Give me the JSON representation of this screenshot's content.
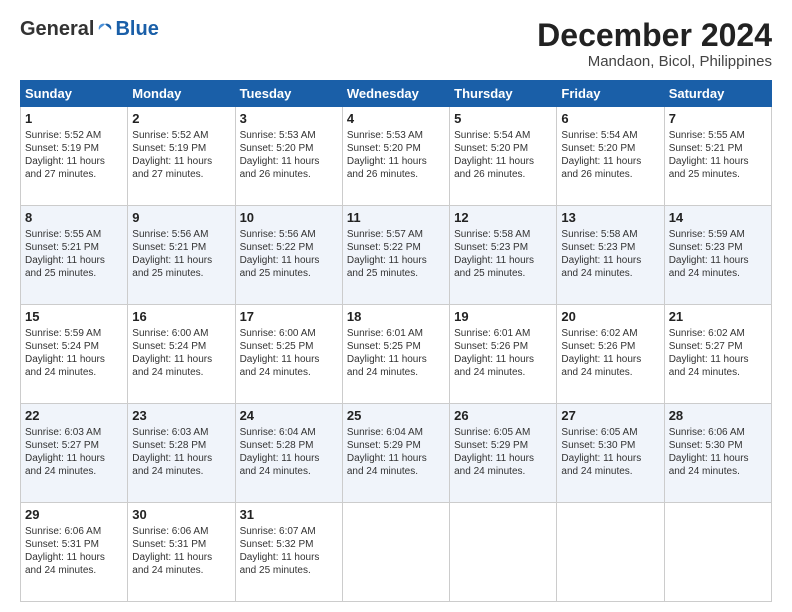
{
  "header": {
    "logo_general": "General",
    "logo_blue": "Blue",
    "month_year": "December 2024",
    "location": "Mandaon, Bicol, Philippines"
  },
  "weekdays": [
    "Sunday",
    "Monday",
    "Tuesday",
    "Wednesday",
    "Thursday",
    "Friday",
    "Saturday"
  ],
  "weeks": [
    [
      {
        "day": "1",
        "info": "Sunrise: 5:52 AM\nSunset: 5:19 PM\nDaylight: 11 hours\nand 27 minutes."
      },
      {
        "day": "2",
        "info": "Sunrise: 5:52 AM\nSunset: 5:19 PM\nDaylight: 11 hours\nand 27 minutes."
      },
      {
        "day": "3",
        "info": "Sunrise: 5:53 AM\nSunset: 5:20 PM\nDaylight: 11 hours\nand 26 minutes."
      },
      {
        "day": "4",
        "info": "Sunrise: 5:53 AM\nSunset: 5:20 PM\nDaylight: 11 hours\nand 26 minutes."
      },
      {
        "day": "5",
        "info": "Sunrise: 5:54 AM\nSunset: 5:20 PM\nDaylight: 11 hours\nand 26 minutes."
      },
      {
        "day": "6",
        "info": "Sunrise: 5:54 AM\nSunset: 5:20 PM\nDaylight: 11 hours\nand 26 minutes."
      },
      {
        "day": "7",
        "info": "Sunrise: 5:55 AM\nSunset: 5:21 PM\nDaylight: 11 hours\nand 25 minutes."
      }
    ],
    [
      {
        "day": "8",
        "info": "Sunrise: 5:55 AM\nSunset: 5:21 PM\nDaylight: 11 hours\nand 25 minutes."
      },
      {
        "day": "9",
        "info": "Sunrise: 5:56 AM\nSunset: 5:21 PM\nDaylight: 11 hours\nand 25 minutes."
      },
      {
        "day": "10",
        "info": "Sunrise: 5:56 AM\nSunset: 5:22 PM\nDaylight: 11 hours\nand 25 minutes."
      },
      {
        "day": "11",
        "info": "Sunrise: 5:57 AM\nSunset: 5:22 PM\nDaylight: 11 hours\nand 25 minutes."
      },
      {
        "day": "12",
        "info": "Sunrise: 5:58 AM\nSunset: 5:23 PM\nDaylight: 11 hours\nand 25 minutes."
      },
      {
        "day": "13",
        "info": "Sunrise: 5:58 AM\nSunset: 5:23 PM\nDaylight: 11 hours\nand 24 minutes."
      },
      {
        "day": "14",
        "info": "Sunrise: 5:59 AM\nSunset: 5:23 PM\nDaylight: 11 hours\nand 24 minutes."
      }
    ],
    [
      {
        "day": "15",
        "info": "Sunrise: 5:59 AM\nSunset: 5:24 PM\nDaylight: 11 hours\nand 24 minutes."
      },
      {
        "day": "16",
        "info": "Sunrise: 6:00 AM\nSunset: 5:24 PM\nDaylight: 11 hours\nand 24 minutes."
      },
      {
        "day": "17",
        "info": "Sunrise: 6:00 AM\nSunset: 5:25 PM\nDaylight: 11 hours\nand 24 minutes."
      },
      {
        "day": "18",
        "info": "Sunrise: 6:01 AM\nSunset: 5:25 PM\nDaylight: 11 hours\nand 24 minutes."
      },
      {
        "day": "19",
        "info": "Sunrise: 6:01 AM\nSunset: 5:26 PM\nDaylight: 11 hours\nand 24 minutes."
      },
      {
        "day": "20",
        "info": "Sunrise: 6:02 AM\nSunset: 5:26 PM\nDaylight: 11 hours\nand 24 minutes."
      },
      {
        "day": "21",
        "info": "Sunrise: 6:02 AM\nSunset: 5:27 PM\nDaylight: 11 hours\nand 24 minutes."
      }
    ],
    [
      {
        "day": "22",
        "info": "Sunrise: 6:03 AM\nSunset: 5:27 PM\nDaylight: 11 hours\nand 24 minutes."
      },
      {
        "day": "23",
        "info": "Sunrise: 6:03 AM\nSunset: 5:28 PM\nDaylight: 11 hours\nand 24 minutes."
      },
      {
        "day": "24",
        "info": "Sunrise: 6:04 AM\nSunset: 5:28 PM\nDaylight: 11 hours\nand 24 minutes."
      },
      {
        "day": "25",
        "info": "Sunrise: 6:04 AM\nSunset: 5:29 PM\nDaylight: 11 hours\nand 24 minutes."
      },
      {
        "day": "26",
        "info": "Sunrise: 6:05 AM\nSunset: 5:29 PM\nDaylight: 11 hours\nand 24 minutes."
      },
      {
        "day": "27",
        "info": "Sunrise: 6:05 AM\nSunset: 5:30 PM\nDaylight: 11 hours\nand 24 minutes."
      },
      {
        "day": "28",
        "info": "Sunrise: 6:06 AM\nSunset: 5:30 PM\nDaylight: 11 hours\nand 24 minutes."
      }
    ],
    [
      {
        "day": "29",
        "info": "Sunrise: 6:06 AM\nSunset: 5:31 PM\nDaylight: 11 hours\nand 24 minutes."
      },
      {
        "day": "30",
        "info": "Sunrise: 6:06 AM\nSunset: 5:31 PM\nDaylight: 11 hours\nand 24 minutes."
      },
      {
        "day": "31",
        "info": "Sunrise: 6:07 AM\nSunset: 5:32 PM\nDaylight: 11 hours\nand 25 minutes."
      },
      {
        "day": "",
        "info": ""
      },
      {
        "day": "",
        "info": ""
      },
      {
        "day": "",
        "info": ""
      },
      {
        "day": "",
        "info": ""
      }
    ]
  ]
}
